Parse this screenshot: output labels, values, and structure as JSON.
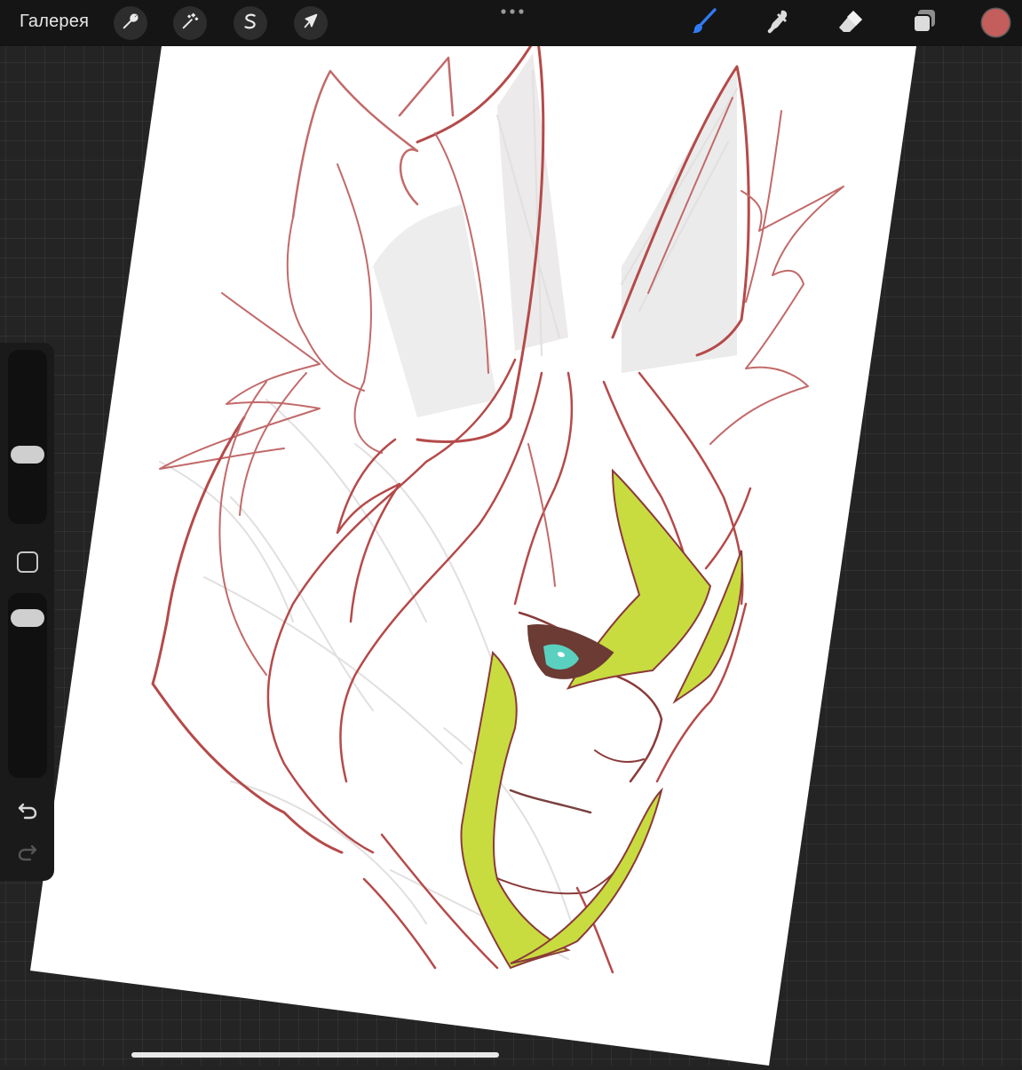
{
  "toolbar": {
    "gallery_label": "Галерея",
    "left_tools": [
      "wrench-icon",
      "magic-wand-icon",
      "selection-s-icon",
      "transform-arrow-icon"
    ],
    "right_tools": [
      "brush-icon",
      "smudge-icon",
      "eraser-icon",
      "layers-icon"
    ],
    "active_tool": "brush-icon",
    "current_color": "#c45e5c",
    "accent_color": "#2f7bf5"
  },
  "sidebar": {
    "brush_size": 0.38,
    "brush_opacity": 0.08
  },
  "canvas": {
    "paper_color": "#ffffff",
    "line_color": "#b54a4a",
    "sketch_color": "#e2dfdf",
    "hair_color": "#c8dc3f",
    "eye_color": "#5ad0c0"
  }
}
